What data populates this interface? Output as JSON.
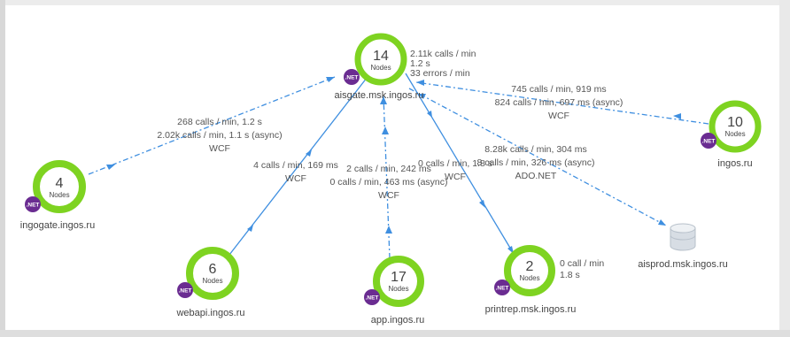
{
  "colors": {
    "ring": "#7ed321",
    "edge": "#3f8fe0",
    "badge": "#6a2c91",
    "database": "#d7dde4"
  },
  "nodes": {
    "aisgate": {
      "count": "14",
      "unit": "Nodes",
      "badge": ".NET",
      "label": "aisgate.msk.ingos.ru",
      "status_line1": "2.11k calls / min",
      "status_line2": "1.2 s",
      "status_line3": "33 errors / min"
    },
    "ingos": {
      "count": "10",
      "unit": "Nodes",
      "badge": ".NET",
      "label": "ingos.ru"
    },
    "ingogate": {
      "count": "4",
      "unit": "Nodes",
      "badge": ".NET",
      "label": "ingogate.ingos.ru"
    },
    "webapi": {
      "count": "6",
      "unit": "Nodes",
      "badge": ".NET",
      "label": "webapi.ingos.ru"
    },
    "app": {
      "count": "17",
      "unit": "Nodes",
      "badge": ".NET",
      "label": "app.ingos.ru"
    },
    "printrep": {
      "count": "2",
      "unit": "Nodes",
      "badge": ".NET",
      "label": "printrep.msk.ingos.ru",
      "status_line1": "0 call / min",
      "status_line2": "1.8 s"
    },
    "aisprod": {
      "icon": "database-icon",
      "label": "aisprod.msk.ingos.ru"
    }
  },
  "edges": {
    "ingos_to_aisgate": {
      "line1": "745 calls / min, 919 ms",
      "line2": "824 calls / min, 697 ms (async)",
      "line3": "WCF"
    },
    "ingogate_to_aisgate": {
      "line1": "268 calls / min, 1.2 s",
      "line2": "2.02k calls / min, 1.1 s (async)",
      "line3": "WCF"
    },
    "webapi_to_aisgate": {
      "line1": "4 calls / min, 169 ms",
      "line2": "WCF"
    },
    "app_to_aisgate": {
      "line1": "2 calls / min, 242 ms",
      "line2": "0 calls / min, 463 ms (async)",
      "line3": "WCF"
    },
    "aisgate_to_printrep": {
      "line1": "0 calls / min, 1.8 s",
      "line2": "WCF"
    },
    "aisgate_to_aisprod": {
      "line1": "8.28k calls / min, 304 ms",
      "line2": "8 calls / min, 326 ms (async)",
      "line3": "ADO.NET"
    }
  }
}
